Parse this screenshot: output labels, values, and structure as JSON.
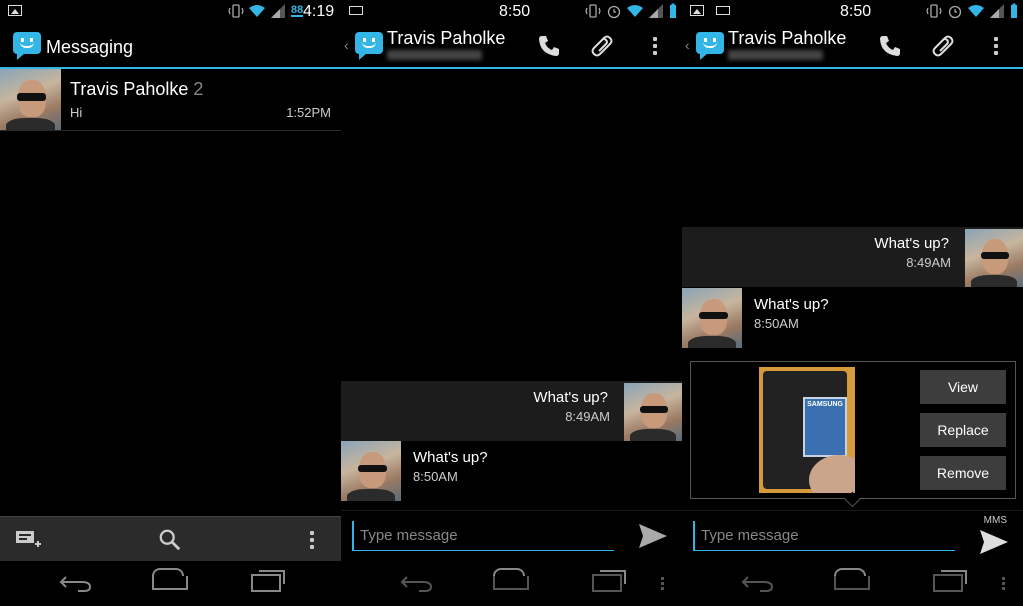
{
  "panels": [
    {
      "status_time": "4:19",
      "status_badge": "88",
      "title": "Messaging",
      "conversations": [
        {
          "name": "Travis Paholke",
          "count": "2",
          "snippet": "Hi",
          "time": "1:52PM"
        }
      ]
    },
    {
      "status_time": "8:50",
      "contact_name": "Travis Paholke",
      "messages": [
        {
          "direction": "out",
          "text": "What's up?",
          "time": "8:49AM"
        },
        {
          "direction": "in",
          "text": "What's up?",
          "time": "8:50AM"
        }
      ],
      "compose_placeholder": "Type message"
    },
    {
      "status_time": "8:50",
      "contact_name": "Travis Paholke",
      "messages": [
        {
          "direction": "out",
          "text": "What's up?",
          "time": "8:49AM"
        },
        {
          "direction": "in",
          "text": "What's up?",
          "time": "8:50AM"
        }
      ],
      "attachment": {
        "thumb_text": "SAMSUNG",
        "buttons": [
          "View",
          "Replace",
          "Remove"
        ]
      },
      "compose_placeholder": "Type message",
      "mms_label": "MMS"
    }
  ],
  "colors": {
    "accent": "#33b5e5",
    "background": "#000000",
    "bar": "#2b2b2b"
  },
  "icons": [
    "gallery-icon",
    "keyboard-icon",
    "vibrate-icon",
    "alarm-icon",
    "wifi-icon",
    "signal-icon",
    "battery-icon",
    "messaging-app-icon",
    "phone-icon",
    "paperclip-icon",
    "overflow-icon",
    "new-message-icon",
    "search-icon",
    "back-nav-icon",
    "home-nav-icon",
    "recents-nav-icon",
    "send-icon"
  ]
}
